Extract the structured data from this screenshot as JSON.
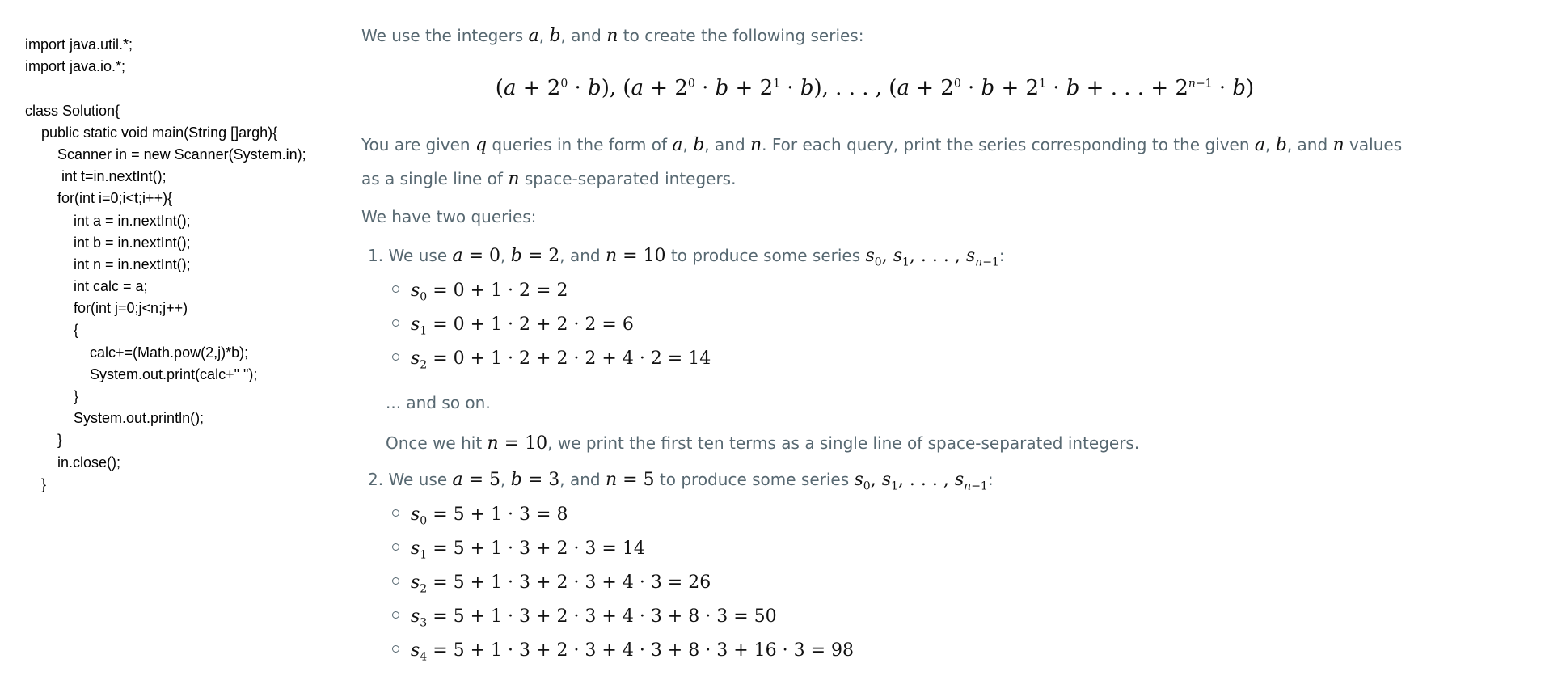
{
  "code_lines": [
    "import java.util.*;",
    "import java.io.*;",
    "",
    "class Solution{",
    "    public static void main(String []argh){",
    "        Scanner in = new Scanner(System.in);",
    "         int t=in.nextInt();",
    "        for(int i=0;i<t;i++){",
    "            int a = in.nextInt();",
    "            int b = in.nextInt();",
    "            int n = in.nextInt();",
    "            int calc = a;",
    "            for(int j=0;j<n;j++)",
    "            {",
    "                calc+=(Math.pow(2,j)*b);",
    "                System.out.print(calc+\" \");",
    "            }",
    "            System.out.println();",
    "        }",
    "        in.close();",
    "    }"
  ],
  "problem": {
    "intro_prefix": "We use the integers ",
    "intro_suffix": " to create the following series:",
    "given_prefix": "You are given ",
    "given_middle": " queries in the form of ",
    "given_suffix": ". For each query, print the series corresponding to the given ",
    "given_suffix2": " values",
    "line2_prefix": "as a single line of ",
    "line2_suffix": " space-separated integers.",
    "two_queries": "We have two queries:",
    "q1_prefix": "We use ",
    "q1_mid": " to produce some series ",
    "and_so_on": "... and so on.",
    "once_prefix": "Once we hit ",
    "once_suffix": ", we print the first ten terms as a single line of space-separated integers.",
    "q2_prefix": "We use ",
    "q2_mid": " to produce some series ",
    "comma": ",",
    "and": ", and ",
    "colon": ":",
    "num1": "1.",
    "num2": "2."
  }
}
